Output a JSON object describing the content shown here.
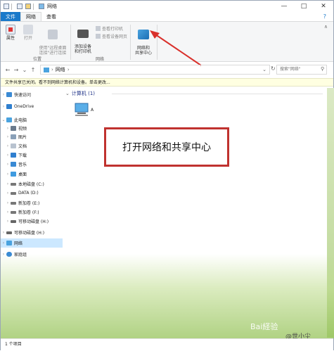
{
  "window": {
    "title": "网络"
  },
  "ribbon": {
    "tabs": [
      "文件",
      "网络",
      "查看"
    ],
    "buttons": {
      "properties": "属性",
      "open": "打开",
      "remote_desktop": "使用\"远程桌面\n连接\"进行连接",
      "add_device": "添加设备\n和打印机",
      "view_printers": "查看打印机",
      "view_device_page": "查看设备网页",
      "network_center": "网络和\n共享中心"
    },
    "groups": {
      "location": "位置",
      "network": "网络"
    }
  },
  "address": {
    "path": "网络",
    "search_placeholder": "搜索\"网络\""
  },
  "infobar": {
    "text": "文件共享已关闭。看不到网络计算机和设备。单击更改..."
  },
  "nav": {
    "items": [
      {
        "label": "快速访问",
        "icon": "star-icon"
      },
      {
        "label": "OneDrive",
        "icon": "cloud-icon"
      },
      {
        "label": "此电脑",
        "icon": "computer-icon"
      },
      {
        "label": "视频",
        "icon": "video-folder-icon"
      },
      {
        "label": "图片",
        "icon": "pictures-folder-icon"
      },
      {
        "label": "文档",
        "icon": "documents-folder-icon"
      },
      {
        "label": "下载",
        "icon": "download-folder-icon"
      },
      {
        "label": "音乐",
        "icon": "music-folder-icon"
      },
      {
        "label": "桌面",
        "icon": "desktop-folder-icon"
      },
      {
        "label": "本地磁盘 (C:)",
        "icon": "drive-icon"
      },
      {
        "label": "DATA (D:)",
        "icon": "drive-icon"
      },
      {
        "label": "新加卷 (E:)",
        "icon": "drive-icon"
      },
      {
        "label": "新加卷 (F:)",
        "icon": "drive-icon"
      },
      {
        "label": "可移动磁盘 (H:)",
        "icon": "usb-drive-icon"
      },
      {
        "label": "可移动磁盘 (H:)",
        "icon": "usb-drive-icon"
      },
      {
        "label": "网络",
        "icon": "network-icon"
      },
      {
        "label": "家庭组",
        "icon": "homegroup-icon"
      }
    ]
  },
  "content": {
    "group_header": "计算机 (1)",
    "computer_label": "A"
  },
  "annotation": {
    "text": "打开网络和共享中心",
    "color": "#c0322f"
  },
  "status": {
    "text": "1 个项目"
  },
  "watermark": {
    "text": "Bai経验",
    "text2": "@世小尘"
  },
  "colors": {
    "file_tab": "#1979ca",
    "accent": "#cce8ff",
    "arrow": "#d9302b"
  }
}
